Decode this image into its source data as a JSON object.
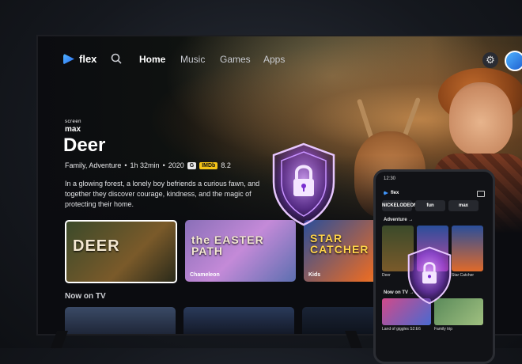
{
  "nav": {
    "brand": "flex",
    "items": [
      {
        "label": "Home",
        "active": true
      },
      {
        "label": "Music"
      },
      {
        "label": "Games"
      },
      {
        "label": "Apps"
      }
    ]
  },
  "hero": {
    "channel_top": "screen",
    "channel_bottom": "max",
    "title": "Deer",
    "genres": "Family, Adventure",
    "duration": "1h 32min",
    "year": "2020",
    "rating": "G",
    "imdb_label": "IMDb",
    "imdb_score": "8.2",
    "description": "In a glowing forest, a lonely boy befriends a curious fawn, and together they discover courage, kindness, and the magic of protecting their home."
  },
  "row": {
    "tiles": [
      {
        "title": "DEER",
        "sub": ""
      },
      {
        "title": "the EASTER PATH",
        "sub": "Chameleon"
      },
      {
        "title": "STAR CATCHER",
        "sub": "Kids"
      }
    ]
  },
  "now_on_tv": {
    "label": "Now on TV"
  },
  "phone": {
    "time": "12:30",
    "brand": "flex",
    "brands": [
      "NICKELODEON",
      "fun",
      "max"
    ],
    "adventure_label": "Adventure →",
    "posters": [
      {
        "label": "Deer"
      },
      {
        "label": ""
      },
      {
        "label": "Star Catcher"
      }
    ],
    "now_on_tv_label": "Now on TV →",
    "tv_tiles": [
      {
        "label": "Land of giggles S2:E6"
      },
      {
        "label": "Family trip"
      }
    ]
  },
  "colors": {
    "accent": "#4fb3ff",
    "shield_glow": "#b06bff",
    "imdb": "#f5c518"
  }
}
